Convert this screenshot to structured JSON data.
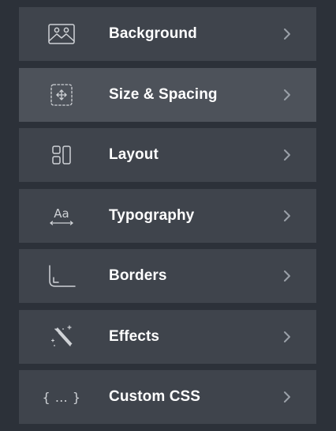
{
  "panel": {
    "items": [
      {
        "label": "Background",
        "icon": "image-icon",
        "active": false
      },
      {
        "label": "Size & Spacing",
        "icon": "move-icon",
        "active": true
      },
      {
        "label": "Layout",
        "icon": "layout-icon",
        "active": false
      },
      {
        "label": "Typography",
        "icon": "typography-icon",
        "active": false
      },
      {
        "label": "Borders",
        "icon": "borders-icon",
        "active": false
      },
      {
        "label": "Effects",
        "icon": "magic-wand-icon",
        "active": false
      },
      {
        "label": "Custom CSS",
        "icon": "braces-icon",
        "active": false
      }
    ],
    "typography_icon_text": "Aa",
    "custom_css_icon_text": "{ … }"
  },
  "colors": {
    "background": "#2c3139",
    "item": "#3f444c",
    "item_active": "#4d525a",
    "text": "#ffffff",
    "icon": "#cfd2d6",
    "chevron": "#9aa0a8"
  }
}
